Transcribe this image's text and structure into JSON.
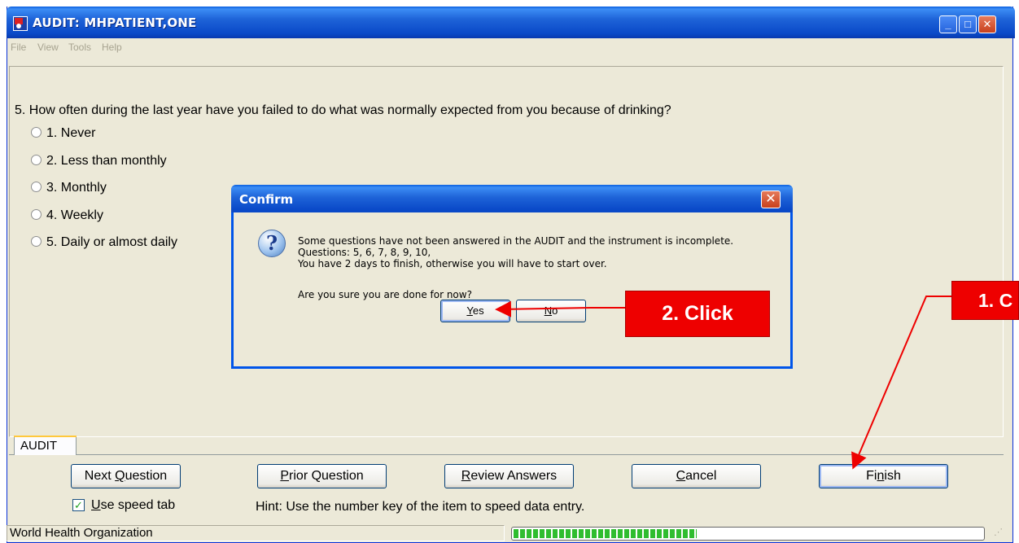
{
  "window": {
    "title": "AUDIT: MHPATIENT,ONE",
    "minimize": "_",
    "maximize": "□",
    "close": "✕"
  },
  "menu": [
    "File",
    "View",
    "Tools",
    "Help"
  ],
  "question": {
    "text": "5. How often during the last year have you failed to do what was normally expected from you because of drinking?",
    "options": [
      "1. Never",
      "2. Less than monthly",
      "3. Monthly",
      "4. Weekly",
      "5. Daily or almost daily"
    ]
  },
  "tab": {
    "label": "AUDIT"
  },
  "buttons": {
    "next": {
      "pre": "Next ",
      "ul": "Q",
      "post": "uestion"
    },
    "prior": {
      "pre": "",
      "ul": "P",
      "post": "rior Question"
    },
    "review": {
      "pre": "",
      "ul": "R",
      "post": "eview Answers"
    },
    "cancel": {
      "pre": "",
      "ul": "C",
      "post": "ancel"
    },
    "finish": {
      "pre": "Fi",
      "ul": "n",
      "post": "ish"
    }
  },
  "speed_tab": {
    "pre": "",
    "ul": "U",
    "post": "se speed tab",
    "checked": "✓"
  },
  "hint": "Hint: Use the number key of the item to speed data entry.",
  "status": {
    "left": "World Health Organization",
    "progress_fraction": 0.39
  },
  "dialog": {
    "title": "Confirm",
    "icon": "question-icon",
    "lines": [
      "Some questions have not been answered in the AUDIT and the instrument is incomplete.",
      "Questions: 5, 6, 7, 8, 9, 10,",
      "You have 2 days to finish, otherwise you will have to start over.",
      "Are you sure you are done for now?"
    ],
    "yes": {
      "ul": "Y",
      "post": "es"
    },
    "no": {
      "ul": "N",
      "post": "o"
    }
  },
  "callouts": {
    "step1": "1. C",
    "step2": "2. Click"
  },
  "colors": {
    "callout": "#ee0000",
    "title_bar": "#0a49c8",
    "window_bg": "#ece9d8"
  }
}
